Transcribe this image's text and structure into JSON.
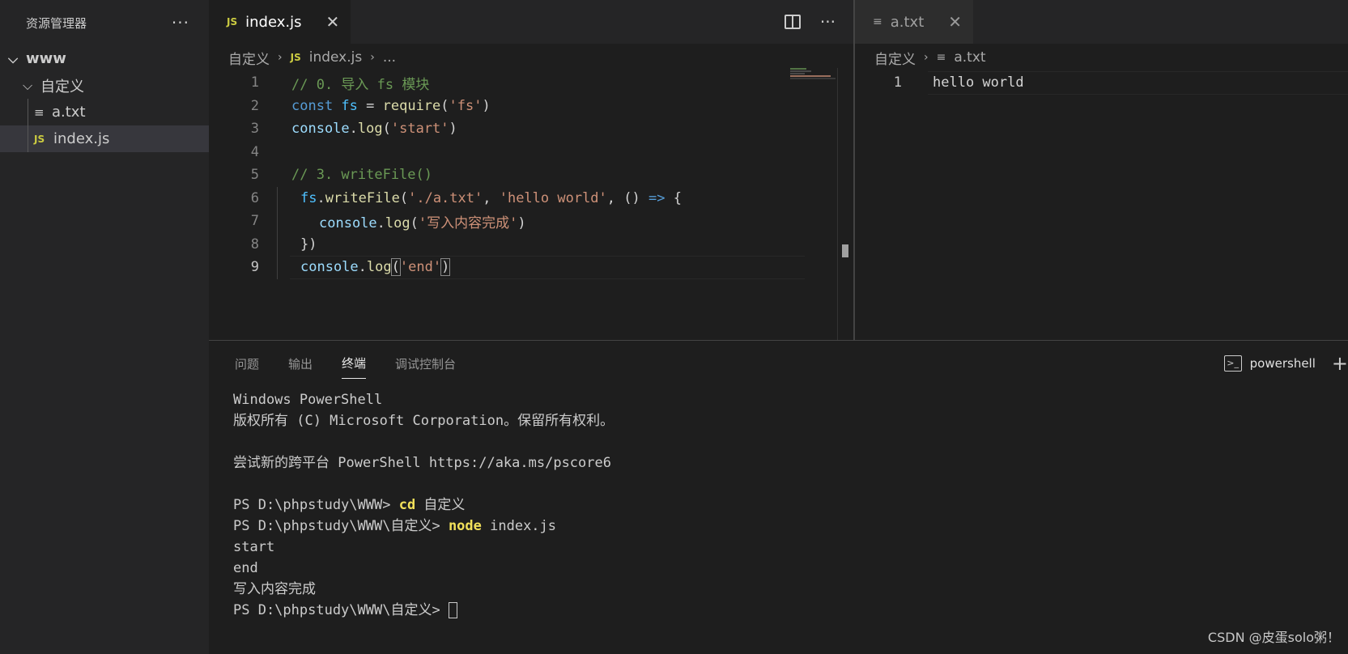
{
  "sidebar": {
    "title": "资源管理器",
    "more": "···",
    "root_folder": "www",
    "subfolder": "自定义",
    "files": [
      {
        "icon": "≡",
        "name": "a.txt"
      },
      {
        "icon": "JS",
        "name": "index.js"
      }
    ]
  },
  "editor_left": {
    "tab": {
      "icon": "JS",
      "label": "index.js",
      "close": "✕"
    },
    "more": "···",
    "breadcrumb": {
      "folder": "自定义",
      "sep": "›",
      "file_icon": "JS",
      "file": "index.js",
      "tail": "..."
    },
    "lines": [
      "1",
      "2",
      "3",
      "4",
      "5",
      "6",
      "7",
      "8",
      "9"
    ],
    "code": {
      "l1": "// 0. 导入 fs 模块",
      "l2_kw": "const",
      "l2_var": " fs",
      "l2_eq": " = ",
      "l2_fn": "require",
      "l2_open": "(",
      "l2_str": "'fs'",
      "l2_close": ")",
      "l3_obj": "console",
      "l3_dot": ".",
      "l3_fn": "log",
      "l3_open": "(",
      "l3_str": "'start'",
      "l3_close": ")",
      "l5": "// 3. writeFile()",
      "l6_obj": "fs",
      "l6_dot": ".",
      "l6_fn": "writeFile",
      "l6_open": "(",
      "l6_str1": "'./a.txt'",
      "l6_comma": ", ",
      "l6_str2": "'hello world'",
      "l6_comma2": ", () ",
      "l6_arrow": "=>",
      "l6_brace": " {",
      "l7_obj": "console",
      "l7_dot": ".",
      "l7_fn": "log",
      "l7_open": "(",
      "l7_str": "'写入内容完成'",
      "l7_close": ")",
      "l8": "})",
      "l9_obj": "console",
      "l9_dot": ".",
      "l9_fn": "log",
      "l9_open": "(",
      "l9_str": "'end'",
      "l9_close": ")"
    }
  },
  "editor_right": {
    "tab": {
      "icon": "≡",
      "label": "a.txt",
      "close": "✕"
    },
    "breadcrumb": {
      "folder": "自定义",
      "sep": "›",
      "file_icon": "≡",
      "file": "a.txt"
    },
    "line_number": "1",
    "content": "hello world"
  },
  "panel": {
    "tabs": [
      "问题",
      "输出",
      "终端",
      "调试控制台"
    ],
    "active_tab": "终端",
    "shell_icon": ">_",
    "shell_label": "powershell",
    "add": "+"
  },
  "terminal": {
    "l1": "Windows PowerShell",
    "l2": "版权所有 (C) Microsoft Corporation。保留所有权利。",
    "l3": "",
    "l4": "尝试新的跨平台 PowerShell https://aka.ms/pscore6",
    "l5": "",
    "l6_prompt": "PS D:\\phpstudy\\WWW> ",
    "l6_cmd": "cd",
    "l6_arg": " 自定义",
    "l7_prompt": "PS D:\\phpstudy\\WWW\\自定义> ",
    "l7_cmd": "node",
    "l7_arg": " index.js",
    "l8": "start",
    "l9": "end",
    "l10": "写入内容完成",
    "l11_prompt": "PS D:\\phpstudy\\WWW\\自定义> "
  },
  "watermark": "CSDN @皮蛋solo粥！"
}
